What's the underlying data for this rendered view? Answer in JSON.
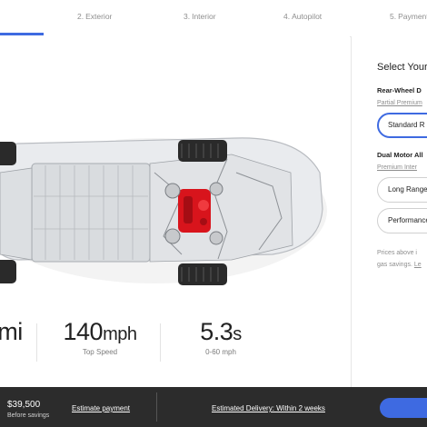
{
  "steps": [
    {
      "num": "2.",
      "label": "Exterior"
    },
    {
      "num": "3.",
      "label": "Interior"
    },
    {
      "num": "4.",
      "label": "Autopilot"
    },
    {
      "num": "5.",
      "label": "Payment"
    }
  ],
  "stats": [
    {
      "value": "mi",
      "unit": "",
      "label": ""
    },
    {
      "value": "140",
      "unit": "mph",
      "label": "Top Speed"
    },
    {
      "value": "5.3",
      "unit": "s",
      "label": "0-60 mph"
    }
  ],
  "panel": {
    "title": "Select Your",
    "rwd_heading": "Rear-Wheel D",
    "rwd_sub": "Partial Premium",
    "opt_standard": "Standard R",
    "awd_heading": "Dual Motor All",
    "awd_sub": "Premium Inter",
    "opt_long": "Long Range",
    "opt_perf": "Performance",
    "note_line1": "Prices above i",
    "note_line2_a": "gas savings. ",
    "note_line2_link": "Le"
  },
  "bottom": {
    "price": "$39,500",
    "price_sub": "Before savings",
    "estimate": "Estimate payment",
    "delivery": "Estimated Delivery: Within 2 weeks"
  },
  "colors": {
    "accent": "#3e6ae1",
    "bottom_bar": "#2c2c2c",
    "motor": "#d8141c"
  }
}
